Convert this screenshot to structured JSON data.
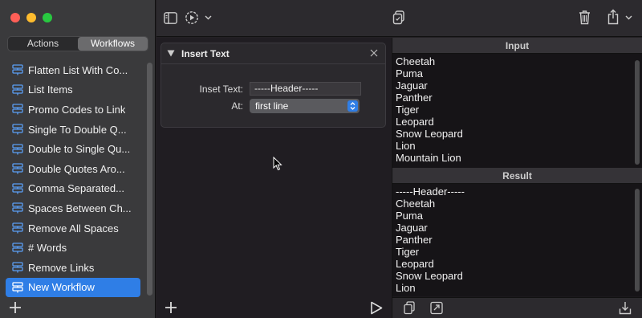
{
  "sidebar": {
    "tabs": [
      {
        "label": "Actions",
        "active": false
      },
      {
        "label": "Workflows",
        "active": true
      }
    ],
    "items": [
      {
        "label": "Flatten List With Co..."
      },
      {
        "label": "List Items"
      },
      {
        "label": "Promo Codes to Link"
      },
      {
        "label": "Single To Double Q..."
      },
      {
        "label": "Double to Single Qu..."
      },
      {
        "label": "Double Quotes Aro..."
      },
      {
        "label": "Comma Separated..."
      },
      {
        "label": "Spaces Between Ch..."
      },
      {
        "label": "Remove All Spaces"
      },
      {
        "label": "# Words"
      },
      {
        "label": "Remove Links"
      },
      {
        "label": "New Workflow"
      }
    ],
    "selected_index": 11
  },
  "action_card": {
    "title": "Insert Text",
    "inset_label": "Inset Text:",
    "inset_value": "-----Header-----",
    "at_label": "At:",
    "at_value": "first line"
  },
  "input_pane": {
    "title": "Input",
    "lines": [
      "Cheetah",
      "Puma",
      "Jaguar",
      "Panther",
      "Tiger",
      "Leopard",
      "Snow Leopard",
      "Lion",
      "Mountain Lion"
    ]
  },
  "result_pane": {
    "title": "Result",
    "lines": [
      "-----Header-----",
      "Cheetah",
      "Puma",
      "Jaguar",
      "Panther",
      "Tiger",
      "Leopard",
      "Snow Leopard",
      "Lion"
    ]
  },
  "colors": {
    "accent": "#2f7ee6",
    "workflow_icon": "#5b9ff5"
  }
}
